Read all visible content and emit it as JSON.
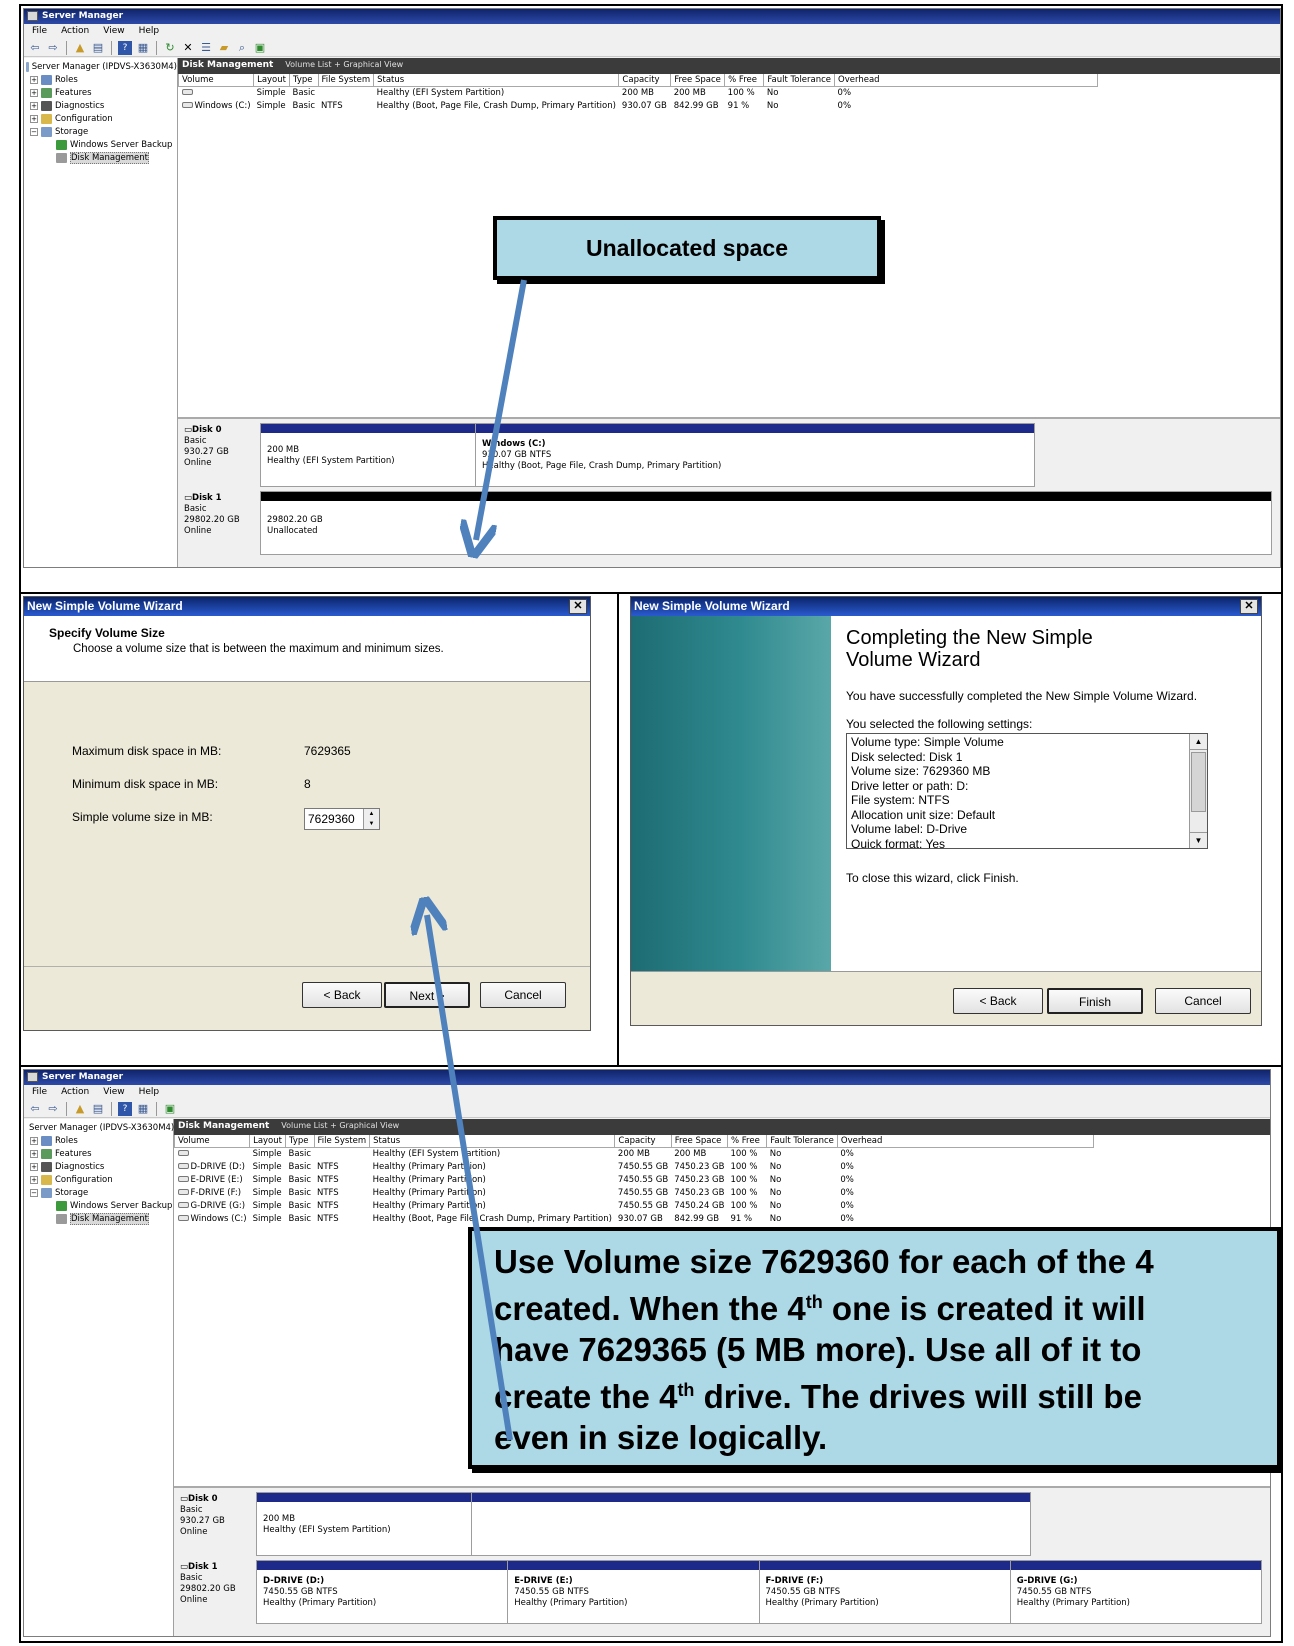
{
  "colors": {
    "accent": "#4f81bd",
    "callout_bg": "#add8e6",
    "titlebar": "#0a246a",
    "partition_bar": "#1e2a8a"
  },
  "server_manager": {
    "title": "Server Manager",
    "menu": [
      "File",
      "Action",
      "View",
      "Help"
    ],
    "tree": [
      {
        "label": "Server Manager (IPDVS-X3630M4)",
        "icon": "server-icon"
      },
      {
        "label": "Roles",
        "icon": "roles-icon",
        "expand": "+"
      },
      {
        "label": "Features",
        "icon": "features-icon",
        "expand": "+"
      },
      {
        "label": "Diagnostics",
        "icon": "diagnostics-icon",
        "expand": "+"
      },
      {
        "label": "Configuration",
        "icon": "configuration-icon",
        "expand": "+"
      },
      {
        "label": "Storage",
        "icon": "storage-icon",
        "expand": "−"
      },
      {
        "label": "Windows Server Backup",
        "icon": "backup-icon"
      },
      {
        "label": "Disk Management",
        "icon": "disk-management-icon"
      }
    ],
    "header_title": "Disk Management",
    "header_view": "Volume List + Graphical View",
    "columns": [
      "Volume",
      "Layout",
      "Type",
      "File System",
      "Status",
      "Capacity",
      "Free Space",
      "% Free",
      "Fault Tolerance",
      "Overhead"
    ]
  },
  "top_volumes": [
    [
      "",
      "Simple",
      "Basic",
      "",
      "Healthy (EFI System Partition)",
      "200 MB",
      "200 MB",
      "100 %",
      "No",
      "0%"
    ],
    [
      "Windows (C:)",
      "Simple",
      "Basic",
      "NTFS",
      "Healthy (Boot, Page File, Crash Dump, Primary Partition)",
      "930.07 GB",
      "842.99 GB",
      "91 %",
      "No",
      "0%"
    ]
  ],
  "top_disks": {
    "disk0": {
      "name": "Disk 0",
      "type": "Basic",
      "size": "930.27 GB",
      "status": "Online",
      "p1_size": "200 MB",
      "p1_status": "Healthy (EFI System Partition)",
      "p2_name": "Windows (C:)",
      "p2_size": "930.07 GB NTFS",
      "p2_status": "Healthy (Boot, Page File, Crash Dump, Primary Partition)"
    },
    "disk1": {
      "name": "Disk 1",
      "type": "Basic",
      "size": "29802.20 GB",
      "status": "Online",
      "p1_size": "29802.20 GB",
      "p1_status": "Unallocated"
    }
  },
  "callout_top": "Unallocated space",
  "wizard_size": {
    "title": "New Simple Volume Wizard",
    "heading": "Specify Volume Size",
    "subheading": "Choose a volume size that is between the maximum and minimum sizes.",
    "max_label": "Maximum disk space in MB:",
    "max_value": "7629365",
    "min_label": "Minimum disk space in MB:",
    "min_value": "8",
    "size_label": "Simple volume size in MB:",
    "size_value": "7629360",
    "back": "< Back",
    "next": "Next >",
    "cancel": "Cancel"
  },
  "wizard_complete": {
    "title": "New Simple Volume Wizard",
    "heading_1": "Completing the New Simple",
    "heading_2": "Volume Wizard",
    "success": "You have successfully completed the New Simple Volume Wizard.",
    "settings_label": "You selected the following settings:",
    "settings": [
      "Volume type: Simple Volume",
      "Disk selected: Disk 1",
      "Volume size: 7629360 MB",
      "Drive letter or path: D:",
      "File system: NTFS",
      "Allocation unit size: Default",
      "Volume label: D-Drive",
      "Quick format: Yes"
    ],
    "close_hint": "To close this wizard, click Finish.",
    "back": "< Back",
    "finish": "Finish",
    "cancel": "Cancel"
  },
  "bottom_volumes": [
    [
      "",
      "Simple",
      "Basic",
      "",
      "Healthy (EFI System Partition)",
      "200 MB",
      "200 MB",
      "100 %",
      "No",
      "0%"
    ],
    [
      "D-DRIVE (D:)",
      "Simple",
      "Basic",
      "NTFS",
      "Healthy (Primary Partition)",
      "7450.55 GB",
      "7450.23 GB",
      "100 %",
      "No",
      "0%"
    ],
    [
      "E-DRIVE (E:)",
      "Simple",
      "Basic",
      "NTFS",
      "Healthy (Primary Partition)",
      "7450.55 GB",
      "7450.23 GB",
      "100 %",
      "No",
      "0%"
    ],
    [
      "F-DRIVE (F:)",
      "Simple",
      "Basic",
      "NTFS",
      "Healthy (Primary Partition)",
      "7450.55 GB",
      "7450.23 GB",
      "100 %",
      "No",
      "0%"
    ],
    [
      "G-DRIVE (G:)",
      "Simple",
      "Basic",
      "NTFS",
      "Healthy (Primary Partition)",
      "7450.55 GB",
      "7450.24 GB",
      "100 %",
      "No",
      "0%"
    ],
    [
      "Windows (C:)",
      "Simple",
      "Basic",
      "NTFS",
      "Healthy (Boot, Page File, Crash Dump, Primary Partition)",
      "930.07 GB",
      "842.99 GB",
      "91 %",
      "No",
      "0%"
    ]
  ],
  "bottom_disks": {
    "disk0": {
      "name": "Disk 0",
      "type": "Basic",
      "size": "930.27 GB",
      "status": "Online",
      "p1_size": "200 MB",
      "p1_status": "Healthy (EFI System Partition)"
    },
    "disk1": {
      "name": "Disk 1",
      "type": "Basic",
      "size": "29802.20 GB",
      "status": "Online",
      "parts": [
        {
          "name": "D-DRIVE (D:)",
          "size": "7450.55 GB NTFS",
          "status": "Healthy (Primary Partition)"
        },
        {
          "name": "E-DRIVE (E:)",
          "size": "7450.55 GB NTFS",
          "status": "Healthy (Primary Partition)"
        },
        {
          "name": "F-DRIVE (F:)",
          "size": "7450.55 GB NTFS",
          "status": "Healthy (Primary Partition)"
        },
        {
          "name": "G-DRIVE (G:)",
          "size": "7450.55 GB NTFS",
          "status": "Healthy (Primary Partition)"
        }
      ]
    }
  },
  "callout_bottom": {
    "l1": "Use Volume size 7629360 for each of the 4",
    "l2a": "created.  When the 4",
    "l2sup": "th",
    "l2b": " one is created it will",
    "l3": "have 7629365 (5 MB more).  Use all of it to",
    "l4a": "create the 4",
    "l4sup": "th",
    "l4b": " drive. The drives will still be",
    "l5": "even in size logically."
  }
}
